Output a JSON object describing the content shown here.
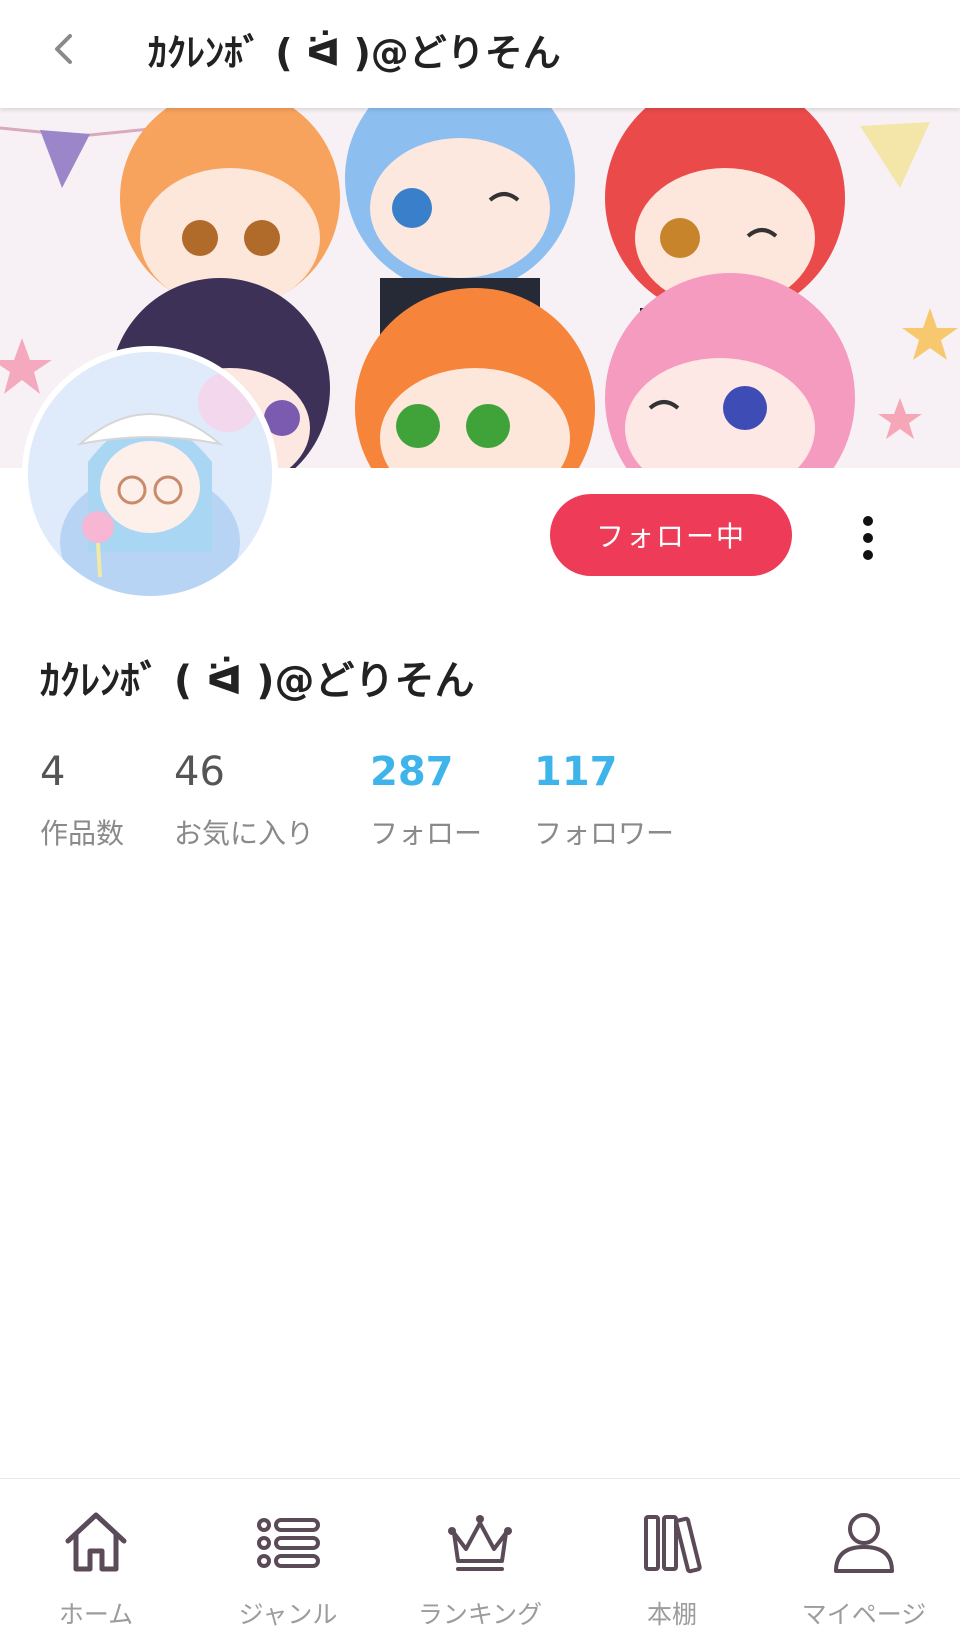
{
  "header": {
    "title": "ｶｸﾚﾝﾎﾞ ( ᐛ )@どりそん"
  },
  "profile": {
    "name": "ｶｸﾚﾝﾎﾞ ( ᐛ )@どりそん",
    "follow_button_label": "フォロー中"
  },
  "stats": [
    {
      "value": "4",
      "label": "作品数"
    },
    {
      "value": "46",
      "label": "お気に入り"
    },
    {
      "value": "287",
      "label": "フォロー"
    },
    {
      "value": "117",
      "label": "フォロワー"
    }
  ],
  "colors": {
    "follow_button": "#ee3b58",
    "link_count": "#3fb4ea",
    "icon": "#5b4a57"
  },
  "bottom_nav": [
    {
      "label": "ホーム",
      "icon": "home-icon"
    },
    {
      "label": "ジャンル",
      "icon": "list-icon"
    },
    {
      "label": "ランキング",
      "icon": "crown-icon"
    },
    {
      "label": "本棚",
      "icon": "bookshelf-icon"
    },
    {
      "label": "マイページ",
      "icon": "person-icon"
    }
  ]
}
